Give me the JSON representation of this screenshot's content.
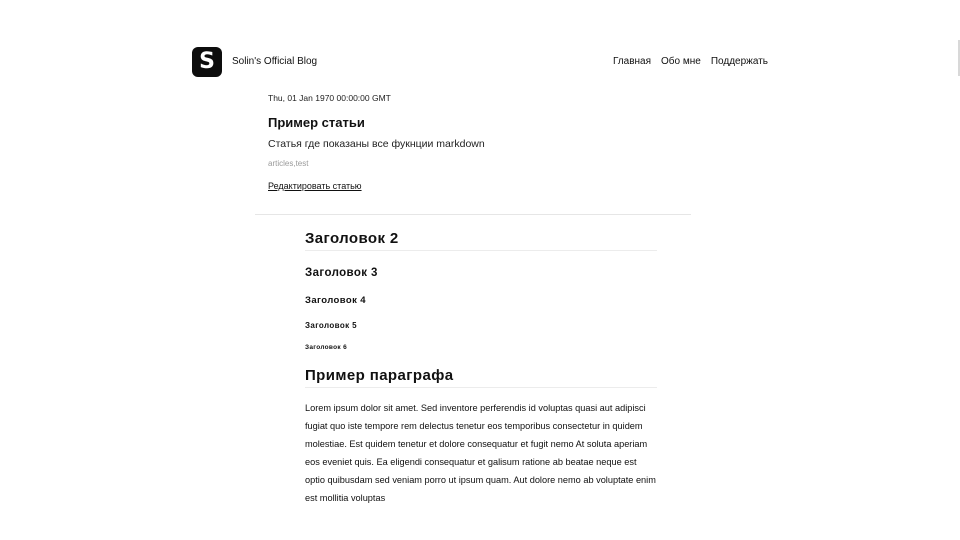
{
  "header": {
    "logo_letter": "S",
    "site_title": "Solin's Official Blog",
    "nav": [
      {
        "label": "Главная"
      },
      {
        "label": "Обо мне"
      },
      {
        "label": "Поддержать"
      }
    ]
  },
  "article": {
    "date": "Thu, 01 Jan 1970 00:00:00 GMT",
    "title": "Пример статьи",
    "description": "Статья где показаны все фукнции markdown",
    "tags": "articles,test",
    "edit_label": "Редактировать статью"
  },
  "content": {
    "h2": "Заголовок 2",
    "h3": "Заголовок 3",
    "h4": "Заголовок 4",
    "h5": "Заголовок 5",
    "h6": "Заголовок 6",
    "paragraph_heading": "Пример параграфа",
    "paragraph": "Lorem ipsum dolor sit amet. Sed inventore perferendis id voluptas quasi aut adipisci fugiat quo iste tempore rem delectus tenetur eos temporibus consectetur in quidem molestiae. Est quidem tenetur et dolore consequatur et fugit nemo At soluta aperiam eos eveniet quis. Ea eligendi consequatur et galisum ratione ab beatae neque est optio quibusdam sed veniam porro ut ipsum quam. Aut dolore nemo ab voluptate enim est mollitia voluptas"
  },
  "colors": {
    "background": "#ffffff",
    "text": "#111111",
    "logo_bg": "#0d0d0d",
    "tags": "#9a9a9a",
    "divider": "#e6e6e6"
  }
}
